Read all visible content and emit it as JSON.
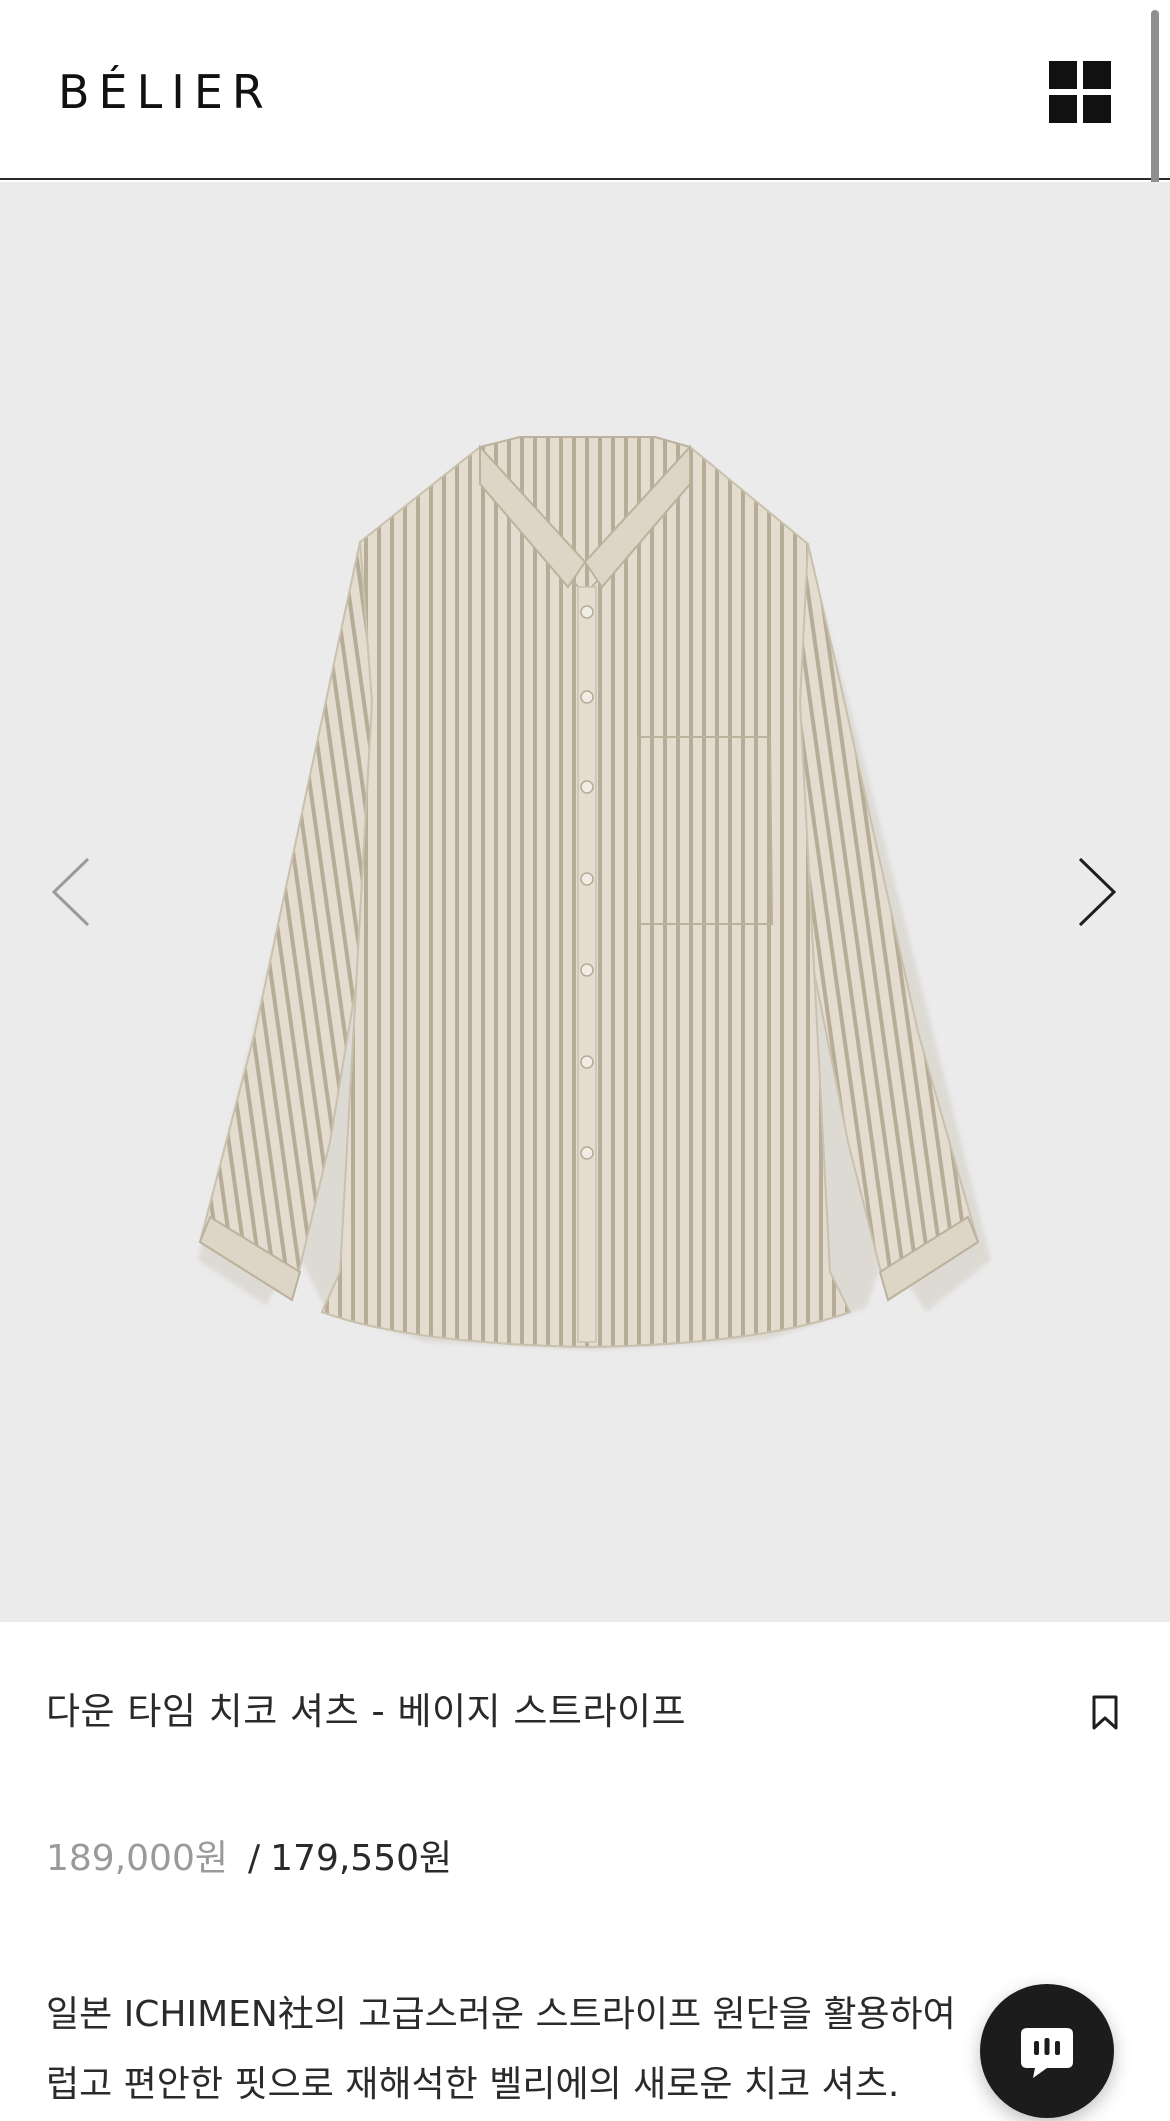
{
  "header": {
    "logo": "BÉLIER",
    "menu_icon": "grid-menu-icon"
  },
  "gallery": {
    "prev_icon": "chevron-left-icon",
    "next_icon": "chevron-right-icon",
    "image_subject": "beige striped shirt"
  },
  "product": {
    "title": "다운 타임 치코 셔츠 - 베이지 스트라이프",
    "bookmark_icon": "bookmark-icon",
    "price_original": "189,000원",
    "price_separator": "/",
    "price_sale": "179,550원",
    "description_lines": [
      "일본 ICHIMEN社의 고급스러운 스트라이프 원단을 활용하여",
      "럽고 편안한 핏으로 재해석한 벨리에의 새로운 치코 셔츠."
    ]
  },
  "chat": {
    "icon": "chat-bubble-icon"
  },
  "colors": {
    "gallery_bg": "#ebebeb",
    "shirt_base": "#ddd5c6",
    "stripe": "#b9ae9a",
    "chat_bg": "#1c1c1c"
  }
}
